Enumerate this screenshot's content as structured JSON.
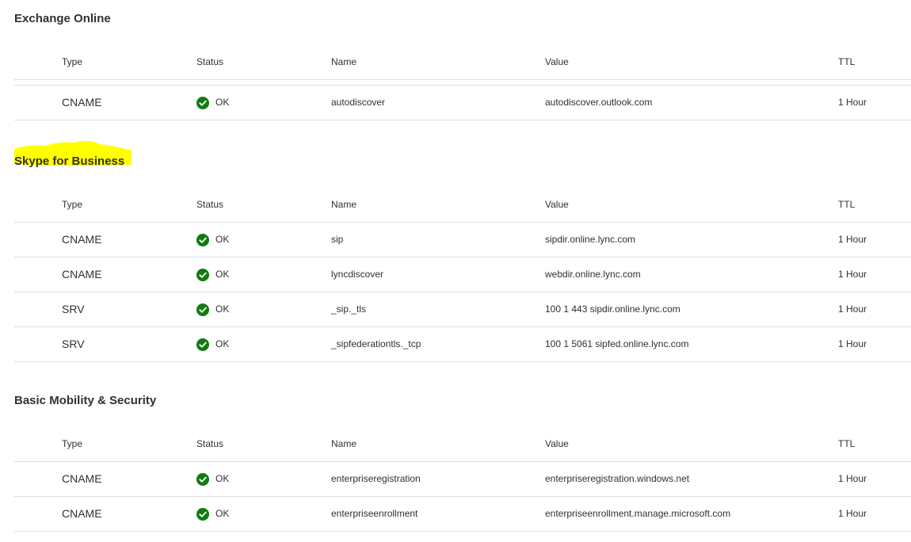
{
  "colors": {
    "ok_green": "#107c10",
    "highlight": "#ffff00",
    "divider": "#e1dfdd",
    "text": "#323130"
  },
  "columns": {
    "type": "Type",
    "status": "Status",
    "name": "Name",
    "value": "Value",
    "ttl": "TTL"
  },
  "status_icon": "check-circle-icon",
  "sections": [
    {
      "title": "Exchange Online",
      "rows": [
        {
          "type": "CNAME",
          "status": "OK",
          "name": "autodiscover",
          "value": "autodiscover.outlook.com",
          "ttl": "1 Hour"
        }
      ]
    },
    {
      "title": "Skype for Business",
      "highlighted": true,
      "rows": [
        {
          "type": "CNAME",
          "status": "OK",
          "name": "sip",
          "value": "sipdir.online.lync.com",
          "ttl": "1 Hour"
        },
        {
          "type": "CNAME",
          "status": "OK",
          "name": "lyncdiscover",
          "value": "webdir.online.lync.com",
          "ttl": "1 Hour"
        },
        {
          "type": "SRV",
          "status": "OK",
          "name": "_sip._tls",
          "value": "100 1 443 sipdir.online.lync.com",
          "ttl": "1 Hour"
        },
        {
          "type": "SRV",
          "status": "OK",
          "name": "_sipfederationtls._tcp",
          "value": "100 1 5061 sipfed.online.lync.com",
          "ttl": "1 Hour"
        }
      ]
    },
    {
      "title": "Basic Mobility & Security",
      "rows": [
        {
          "type": "CNAME",
          "status": "OK",
          "name": "enterpriseregistration",
          "value": "enterpriseregistration.windows.net",
          "ttl": "1 Hour"
        },
        {
          "type": "CNAME",
          "status": "OK",
          "name": "enterpriseenrollment",
          "value": "enterpriseenrollment.manage.microsoft.com",
          "ttl": "1 Hour"
        }
      ]
    }
  ]
}
